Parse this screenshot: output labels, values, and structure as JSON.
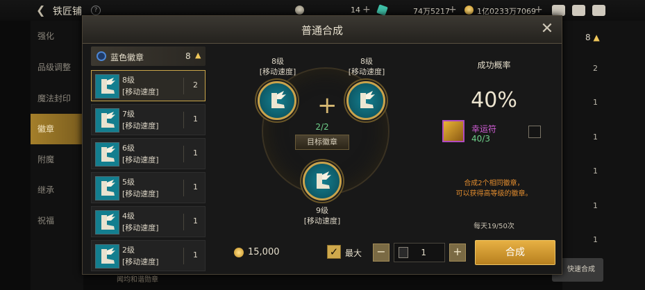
{
  "topbar": {
    "title": "铁匠铺",
    "help": "?",
    "currency1_amount": "14",
    "currency2_amount": "74万5217",
    "currency3_amount": "1亿0233万7069",
    "plus": "+",
    "colors": {
      "gem": "#3fc0a8",
      "gold": "#e3b548",
      "silver": "#c8c0a8"
    }
  },
  "side_menu": {
    "items": [
      {
        "label": "强化"
      },
      {
        "label": "品级调整"
      },
      {
        "label": "魔法封印"
      },
      {
        "label": "徽章",
        "active": true
      },
      {
        "label": "附魔"
      },
      {
        "label": "继承"
      },
      {
        "label": "祝福"
      }
    ]
  },
  "background_right": {
    "header_count": "8",
    "counts": [
      "2",
      "1",
      "1",
      "1",
      "1",
      "1",
      "1"
    ],
    "quick_synth": "快速合成"
  },
  "modal": {
    "title": "普通合成",
    "close_icon": "close-icon"
  },
  "list": {
    "header_label": "蓝色徽章",
    "header_count": "8",
    "items": [
      {
        "level": "8级",
        "name": "[移动速度]",
        "count": "2",
        "selected": true
      },
      {
        "level": "7级",
        "name": "[移动速度]",
        "count": "1"
      },
      {
        "level": "6级",
        "name": "[移动速度]",
        "count": "1"
      },
      {
        "level": "5级",
        "name": "[移动速度]",
        "count": "1"
      },
      {
        "level": "4级",
        "name": "[移动速度]",
        "count": "1"
      },
      {
        "level": "2级",
        "name": "[移动速度]",
        "count": "1"
      }
    ]
  },
  "synthesis": {
    "material_left": {
      "level": "8级",
      "name": "[移动速度]"
    },
    "material_right": {
      "level": "8级",
      "name": "[移动速度]"
    },
    "progress": "2/2",
    "target_label": "目标徽章",
    "result": {
      "level": "9级",
      "name": "[移动速度]"
    }
  },
  "rate_panel": {
    "title": "成功概率",
    "value": "40%",
    "charm_name": "幸运符",
    "charm_count": "40/3",
    "hint_line1": "合成2个相同徽章，",
    "hint_line2": "可以获得高等级的徽章。",
    "daily": "每天19/50次"
  },
  "bottom": {
    "gold": "15,000",
    "max_label": "最大",
    "quantity": "1",
    "minus": "−",
    "plus": "+",
    "synth_button": "合成",
    "peek_text": "闻均和谐勋章"
  }
}
